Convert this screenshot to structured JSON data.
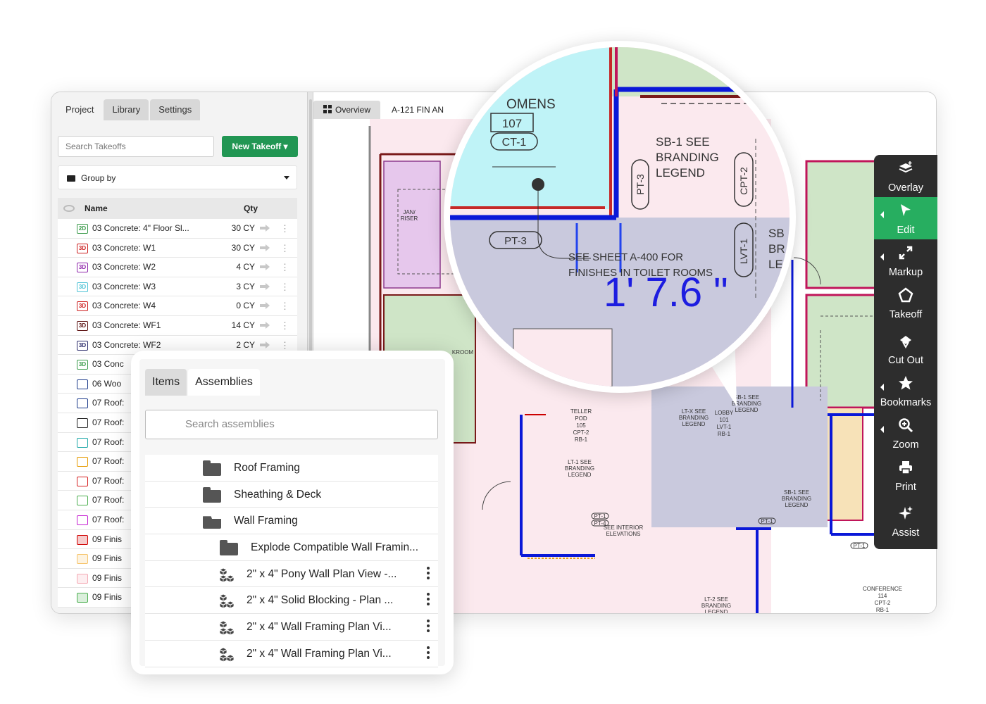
{
  "left_panel": {
    "tabs": [
      "Project",
      "Library",
      "Settings"
    ],
    "search_placeholder": "Search Takeoffs",
    "new_takeoff_label": "New Takeoff ▾",
    "group_by_label": "Group by",
    "col_name": "Name",
    "col_qty": "Qty",
    "rows": [
      {
        "badge": "2D",
        "color": "#3a9a4a",
        "name": "03 Concrete: 4\" Floor Sl...",
        "qty": "30 CY"
      },
      {
        "badge": "3D",
        "color": "#cc1f1f",
        "name": "03 Concrete: W1",
        "qty": "30 CY"
      },
      {
        "badge": "3D",
        "color": "#8e24aa",
        "name": "03 Concrete: W2",
        "qty": "4 CY"
      },
      {
        "badge": "3D",
        "color": "#4fc3d6",
        "name": "03 Concrete: W3",
        "qty": "3 CY"
      },
      {
        "badge": "3D",
        "color": "#cc1f1f",
        "name": "03 Concrete: W4",
        "qty": "0 CY"
      },
      {
        "badge": "3D",
        "color": "#5b1010",
        "name": "03 Concrete: WF1",
        "qty": "14 CY"
      },
      {
        "badge": "3D",
        "color": "#2a2a6a",
        "name": "03 Concrete: WF2",
        "qty": "2 CY"
      },
      {
        "badge": "3D",
        "color": "#3a9a4a",
        "name": "03 Conc",
        "qty": ""
      },
      {
        "badge": "",
        "color": "#1b3a8a",
        "name": "06 Woo",
        "qty": ""
      },
      {
        "badge": "",
        "color": "#1b3a8a",
        "name": "07 Roof:",
        "qty": ""
      },
      {
        "badge": "",
        "color": "#222222",
        "name": "07 Roof:",
        "qty": ""
      },
      {
        "badge": "",
        "color": "#1ea7a7",
        "name": "07 Roof:",
        "qty": ""
      },
      {
        "badge": "",
        "color": "#e69a00",
        "name": "07 Roof:",
        "qty": ""
      },
      {
        "badge": "",
        "color": "#d62020",
        "name": "07 Roof:",
        "qty": ""
      },
      {
        "badge": "",
        "color": "#4caf50",
        "name": "07 Roof:",
        "qty": ""
      },
      {
        "badge": "",
        "color": "#c51fd1",
        "name": "07 Roof:",
        "qty": ""
      },
      {
        "badge": "",
        "color": "#d00000",
        "name": "09 Finis",
        "qty": ""
      },
      {
        "badge": "",
        "color": "#f6c46a",
        "name": "09 Finis",
        "qty": ""
      },
      {
        "badge": "",
        "color": "#f4a9b4",
        "name": "09 Finis",
        "qty": ""
      },
      {
        "badge": "",
        "color": "#4caf50",
        "name": "09 Finis",
        "qty": ""
      }
    ]
  },
  "drawing": {
    "tabs": [
      "Overview",
      "A-121 FIN AN"
    ],
    "magnifier": {
      "room_name": "OMENS",
      "room_number": "107",
      "room_tag": "CT-1",
      "note_1": "SB-1 SEE\nBRANDING\nLEGEND",
      "pt3": "PT-3",
      "cpt2": "CPT-2",
      "lvt1": "LVT-1",
      "see_sheet": "SEE SHEET A-400 FOR\nFINISHES IN TOILET ROOMS",
      "measurement": "1' 7.6 \""
    },
    "plan_labels": {
      "teller": "TELLER\nPOD\n105\nCPT-2\nRB-1",
      "lobby": "LOBBY\n101\nLVT-1\nRB-1",
      "conference": "CONFERENCE\n114\nCPT-2\nRB-1",
      "ltx": "LT-X SEE\nBRANDING\nLEGEND",
      "lt1": "LT-1 SEE\nBRANDING\nLEGEND",
      "lt2": "LT-2 SEE\nBRANDING\nLEGEND",
      "sb1": "SB-1 SEE\nBRANDING\nLEGEND",
      "see_interior": "SEE INTERIOR\nELEVATIONS",
      "janitor": "JAN/\nRISER",
      "breakroom": "KROOM",
      "pt1": "PT-1",
      "pt4": "PT-4"
    }
  },
  "toolbar": {
    "items": [
      "Overlay",
      "Edit",
      "Markup",
      "Takeoff",
      "Cut Out",
      "Bookmarks",
      "Zoom",
      "Print",
      "Assist"
    ],
    "active": "Edit",
    "accent": "#27ae60"
  },
  "assemblies_popup": {
    "tabs": [
      "Items",
      "Assemblies"
    ],
    "search_placeholder": "Search assemblies",
    "items": [
      {
        "type": "folder",
        "label": "Roof Framing",
        "indent": 1
      },
      {
        "type": "folder",
        "label": "Sheathing & Deck",
        "indent": 1
      },
      {
        "type": "folder-open",
        "label": "Wall Framing",
        "indent": 1
      },
      {
        "type": "folder",
        "label": "Explode Compatible Wall Framin...",
        "indent": 2
      },
      {
        "type": "assembly",
        "label": "2\" x 4\" Pony Wall Plan View -...",
        "indent": 2
      },
      {
        "type": "assembly",
        "label": "2\" x 4\" Solid Blocking - Plan ...",
        "indent": 2
      },
      {
        "type": "assembly",
        "label": "2\" x 4\" Wall Framing Plan Vi...",
        "indent": 2
      },
      {
        "type": "assembly",
        "label": "2\" x 4\" Wall Framing Plan Vi...",
        "indent": 2
      }
    ]
  }
}
